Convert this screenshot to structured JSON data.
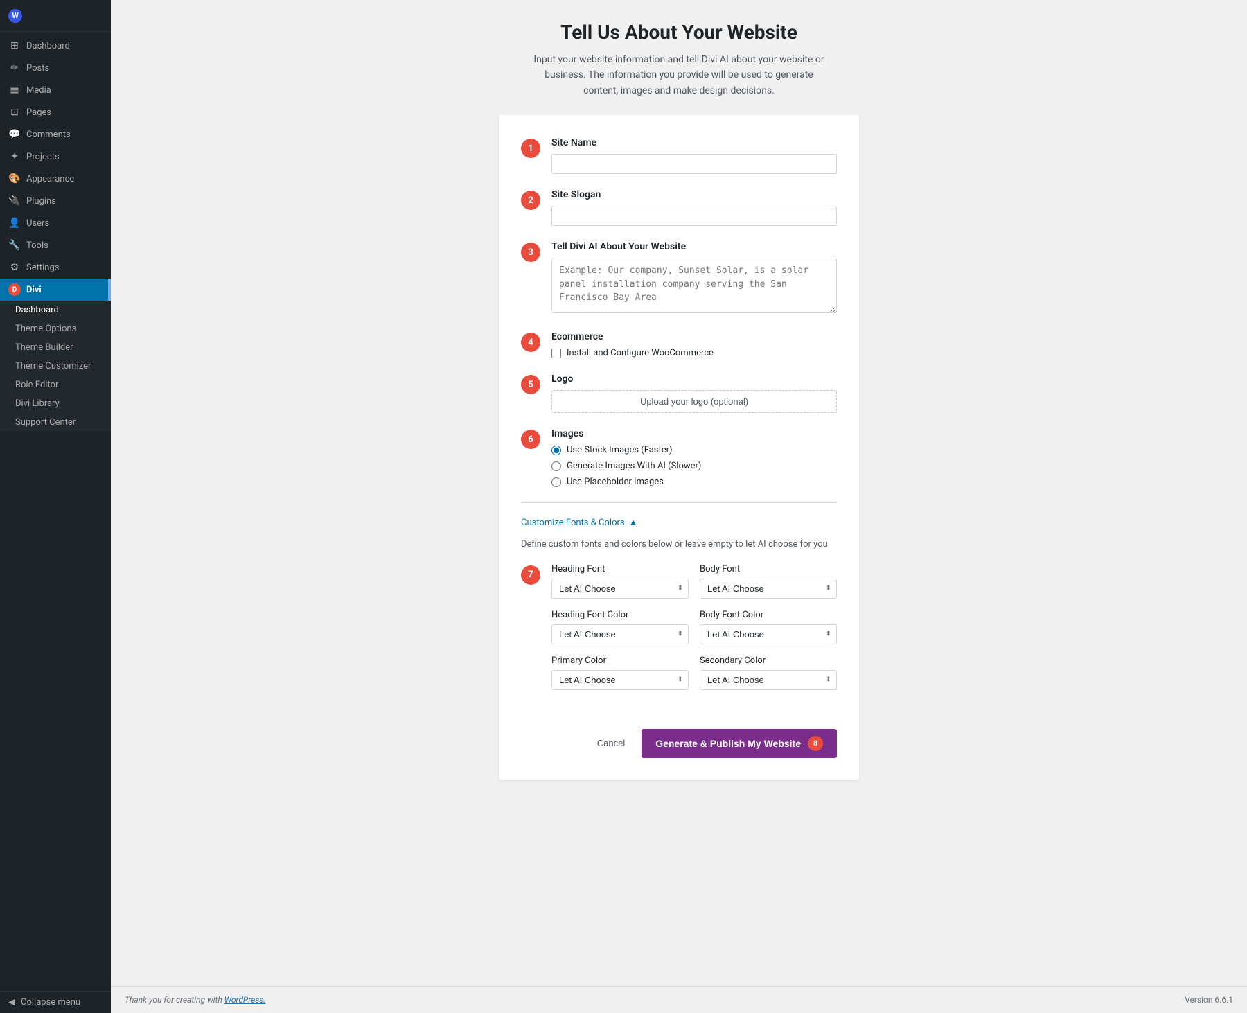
{
  "sidebar": {
    "logo": {
      "icon": "W",
      "text": ""
    },
    "items": [
      {
        "id": "dashboard",
        "label": "Dashboard",
        "icon": "⊞"
      },
      {
        "id": "posts",
        "label": "Posts",
        "icon": "✏"
      },
      {
        "id": "media",
        "label": "Media",
        "icon": "⊟"
      },
      {
        "id": "pages",
        "label": "Pages",
        "icon": "⊡"
      },
      {
        "id": "comments",
        "label": "Comments",
        "icon": "💬"
      },
      {
        "id": "projects",
        "label": "Projects",
        "icon": "✦"
      },
      {
        "id": "appearance",
        "label": "Appearance",
        "icon": "🎨"
      },
      {
        "id": "plugins",
        "label": "Plugins",
        "icon": "🔌"
      },
      {
        "id": "users",
        "label": "Users",
        "icon": "👤"
      },
      {
        "id": "tools",
        "label": "Tools",
        "icon": "🔧"
      },
      {
        "id": "settings",
        "label": "Settings",
        "icon": "⚙"
      }
    ],
    "divi": {
      "label": "Divi",
      "icon": "D",
      "sub_items": [
        {
          "id": "divi-dashboard",
          "label": "Dashboard"
        },
        {
          "id": "theme-options",
          "label": "Theme Options"
        },
        {
          "id": "theme-builder",
          "label": "Theme Builder"
        },
        {
          "id": "theme-customizer",
          "label": "Theme Customizer"
        },
        {
          "id": "role-editor",
          "label": "Role Editor"
        },
        {
          "id": "divi-library",
          "label": "Divi Library"
        },
        {
          "id": "support-center",
          "label": "Support Center"
        }
      ]
    },
    "collapse_label": "Collapse menu"
  },
  "page": {
    "title": "Tell Us About Your Website",
    "description": "Input your website information and tell Divi AI about your website or business. The information you provide will be used to generate content, images and make design decisions."
  },
  "form": {
    "step1": {
      "number": "1",
      "label": "Site Name",
      "placeholder": ""
    },
    "step2": {
      "number": "2",
      "label": "Site Slogan",
      "placeholder": ""
    },
    "step3": {
      "number": "3",
      "label": "Tell Divi AI About Your Website",
      "placeholder": "Example: Our company, Sunset Solar, is a solar panel installation company serving the San Francisco Bay Area"
    },
    "step4": {
      "number": "4",
      "label": "Ecommerce",
      "checkbox_label": "Install and Configure WooCommerce"
    },
    "step5": {
      "number": "5",
      "label": "Logo",
      "upload_label": "Upload your logo (optional)"
    },
    "step6": {
      "number": "6",
      "label": "Images",
      "options": [
        {
          "id": "stock",
          "label": "Use Stock Images (Faster)",
          "checked": true
        },
        {
          "id": "ai",
          "label": "Generate Images With AI (Slower)",
          "checked": false
        },
        {
          "id": "placeholder",
          "label": "Use Placeholder Images",
          "checked": false
        }
      ]
    },
    "customize_section": {
      "toggle_label": "Customize Fonts & Colors",
      "description": "Define custom fonts and colors below or leave empty to let AI choose for you",
      "step_number": "7",
      "fields": {
        "heading_font": {
          "label": "Heading Font",
          "value": "Let AI Choose"
        },
        "body_font": {
          "label": "Body Font",
          "value": "Let AI Choose"
        },
        "heading_font_color": {
          "label": "Heading Font Color",
          "value": "Let AI Choose"
        },
        "body_font_color": {
          "label": "Body Font Color",
          "value": "Let AI Choose"
        },
        "primary_color": {
          "label": "Primary Color",
          "value": "Let AI Choose"
        },
        "secondary_color": {
          "label": "Secondary Color",
          "value": "Let AI Choose"
        }
      },
      "select_options": [
        "Let AI Choose"
      ]
    },
    "actions": {
      "cancel_label": "Cancel",
      "generate_label": "Generate & Publish My Website",
      "generate_badge": "8"
    }
  },
  "footer": {
    "text_before_link": "Thank you for creating with ",
    "link_text": "WordPress.",
    "version_label": "Version 6.6.1"
  }
}
